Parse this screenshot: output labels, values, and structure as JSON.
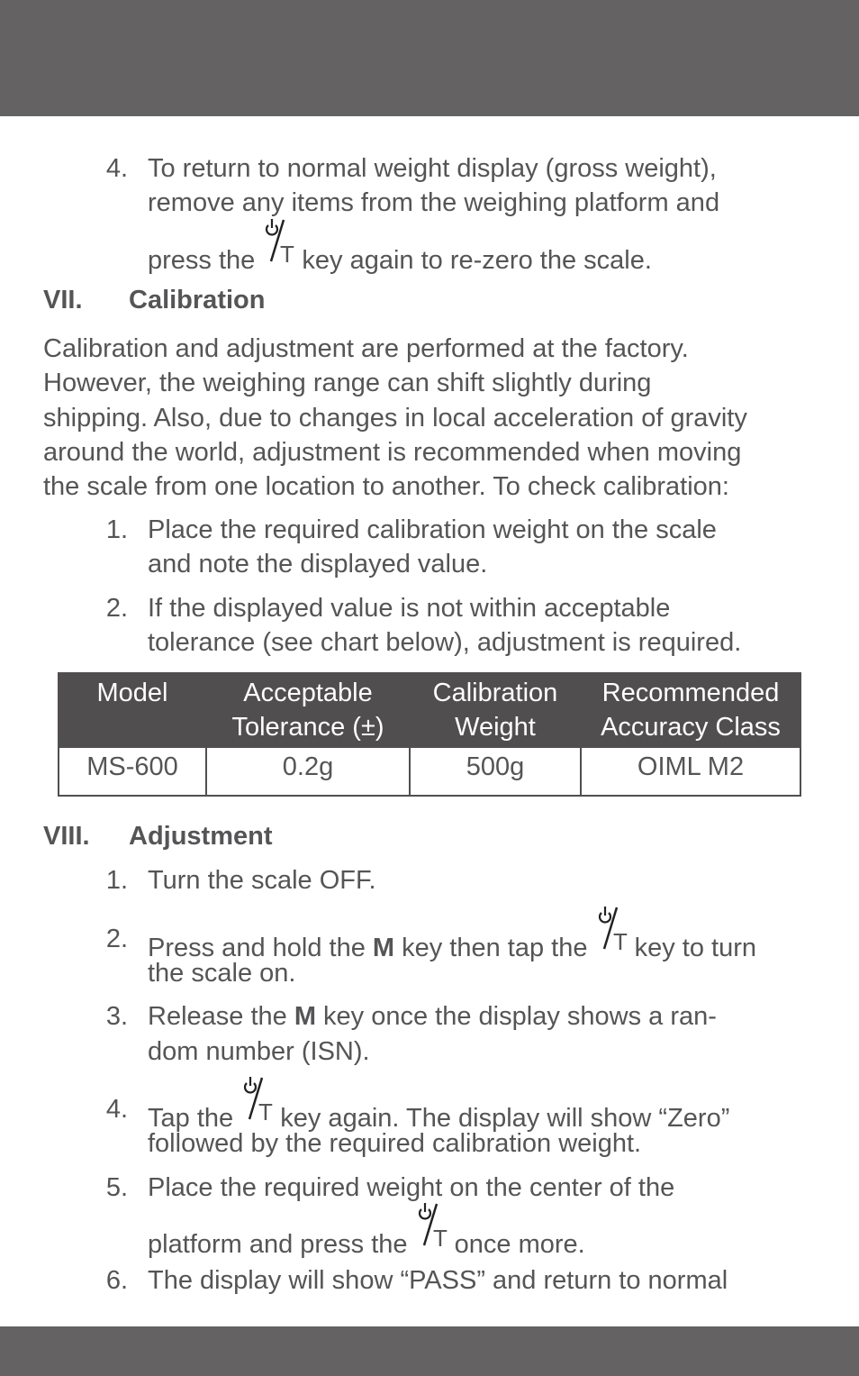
{
  "header_bar": {
    "color": "#646263"
  },
  "footer_bar": {
    "color": "#646263"
  },
  "intro_item": {
    "number": "4.",
    "lines": [
      "To return to normal weight display (gross weight),",
      "remove any items from the weighing platform and",
      "press the",
      "key again to re-zero the scale."
    ]
  },
  "calibration": {
    "numeral": "VII.",
    "title": "Calibration",
    "paragraph": [
      "Calibration and adjustment are performed at the factory.",
      "However, the weighing range can shift slightly during",
      "shipping. Also, due to changes in local acceleration of gravity",
      "around the world, adjustment is recommended when moving",
      "the scale from one location to another. To check calibration:"
    ],
    "steps": [
      {
        "number": "1.",
        "lines": [
          "Place the required calibration weight on the scale",
          "and note the displayed value."
        ]
      },
      {
        "number": "2.",
        "lines": [
          "If the displayed value is not within acceptable",
          "tolerance (see chart below), adjustment is required."
        ]
      }
    ],
    "table": {
      "headers": [
        [
          "Model",
          ""
        ],
        [
          "Acceptable",
          "Tolerance (±)"
        ],
        [
          "Calibration",
          "Weight"
        ],
        [
          "Recommended",
          "Accuracy Class"
        ]
      ],
      "rows": [
        [
          "MS-600",
          "0.2g",
          "500g",
          "OIML M2"
        ]
      ]
    }
  },
  "adjustment": {
    "numeral": "VIII.",
    "title": "Adjustment",
    "steps": [
      {
        "number": "1.",
        "line1": "Turn the scale OFF."
      },
      {
        "number": "2.",
        "pre": "Press and hold the ",
        "bold": "M",
        "mid": " key then tap the ",
        "post": "key to turn",
        "line2": "the scale on."
      },
      {
        "number": "3.",
        "pre": "Release the ",
        "bold": "M",
        "post": " key once the display shows a ran-",
        "line2": "dom number (ISN)."
      },
      {
        "number": "4.",
        "pre": "Tap the ",
        "post": "key again. The display will show “Zero”",
        "line2": "followed by the required calibration weight."
      },
      {
        "number": "5.",
        "line1": "Place the required weight on the center of the",
        "pre2": "platform and press the ",
        "post2": "once more."
      },
      {
        "number": "6.",
        "line1": "The display will show “PASS” and return to normal"
      }
    ]
  },
  "icons": {
    "power_tare_key": "power-tare-key-icon",
    "key_label": "T"
  }
}
